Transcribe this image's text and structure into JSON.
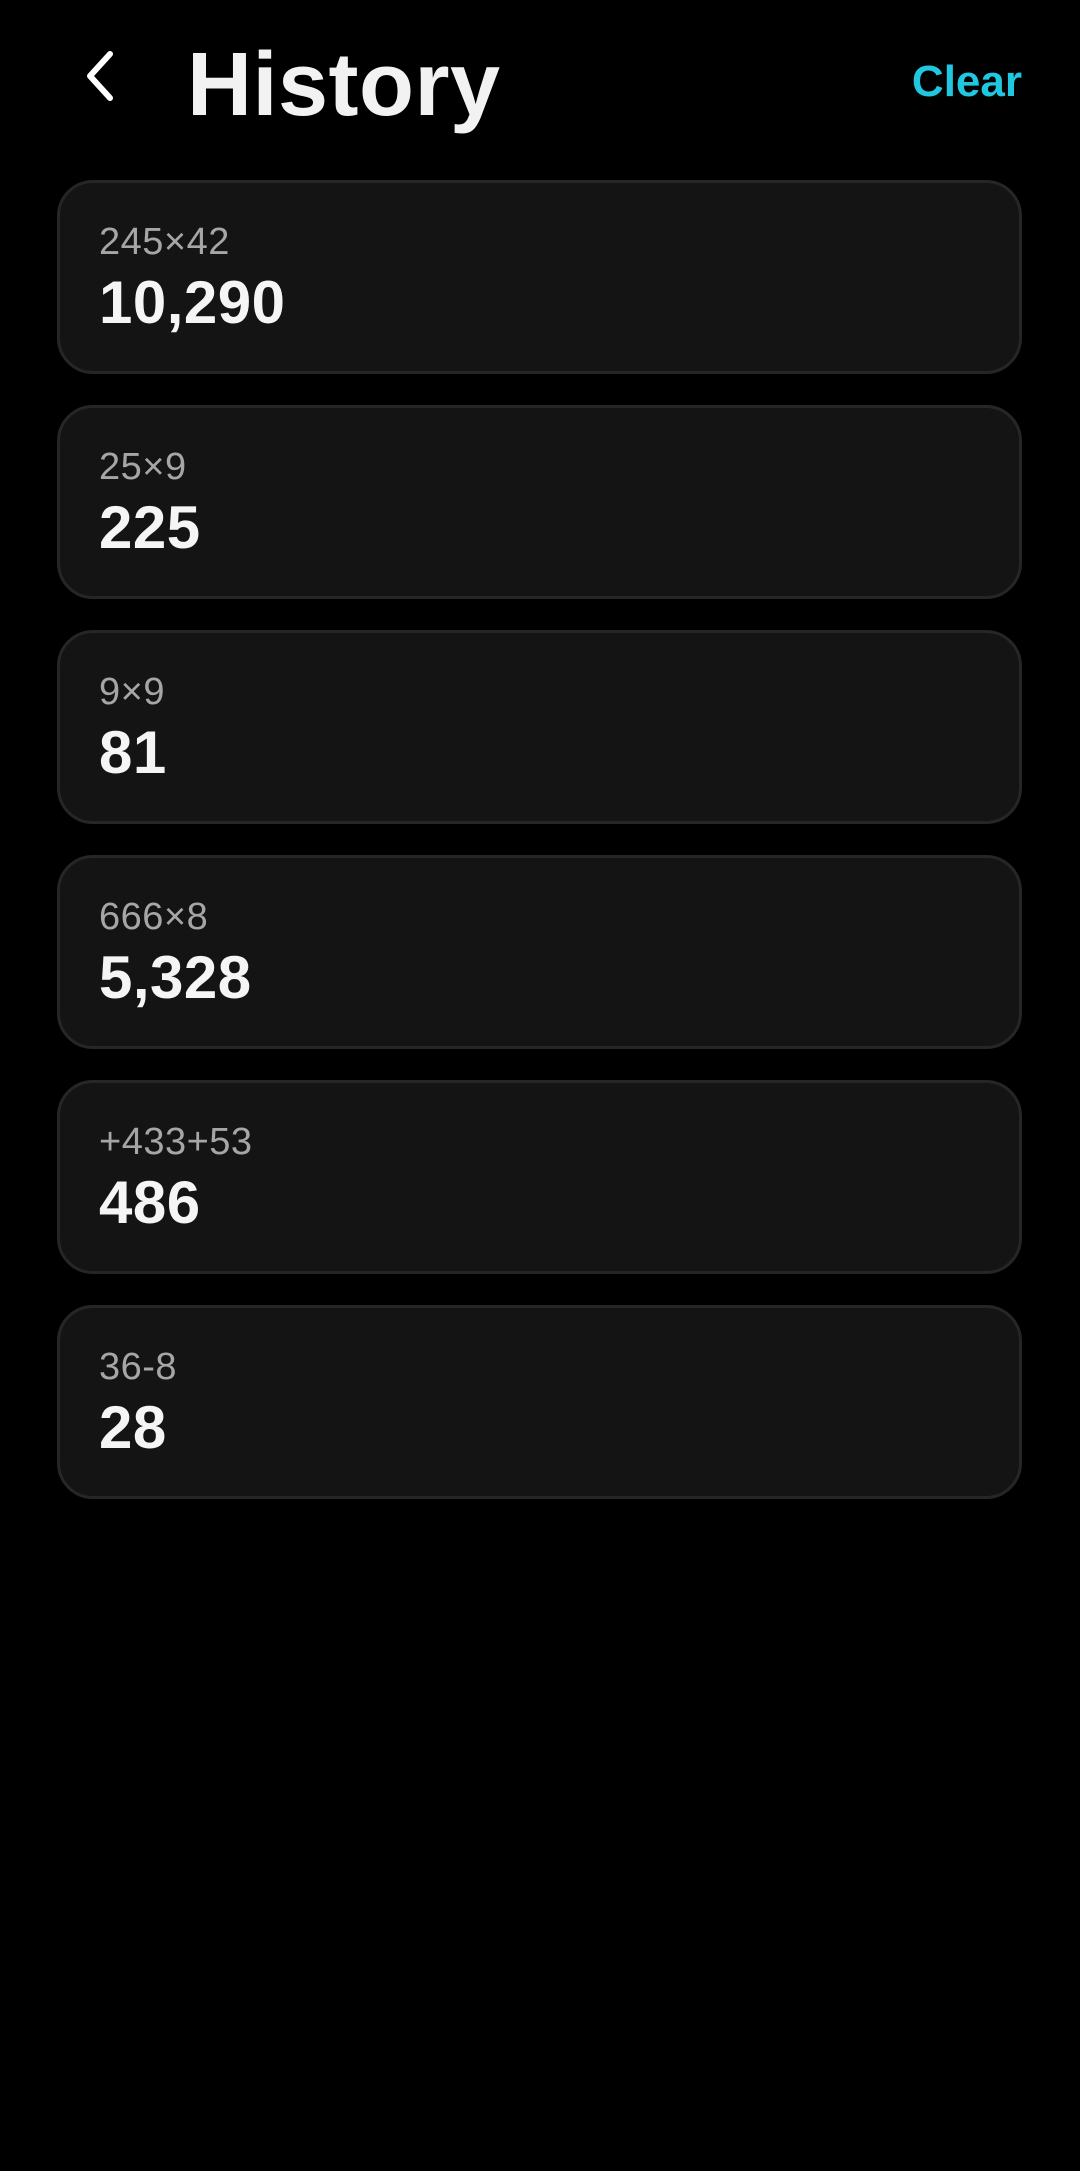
{
  "header": {
    "title": "History",
    "clear_label": "Clear",
    "back_icon": "chevron-left-icon"
  },
  "colors": {
    "background": "#000000",
    "card": "#141414",
    "accent": "#1fc8e0",
    "expression_text": "#a6a6a6",
    "result_text": "#f5f5f5"
  },
  "history": [
    {
      "expression": "245×42",
      "result": "10,290"
    },
    {
      "expression": "25×9",
      "result": "225"
    },
    {
      "expression": "9×9",
      "result": "81"
    },
    {
      "expression": "666×8",
      "result": "5,328"
    },
    {
      "expression": "+433+53",
      "result": "486"
    },
    {
      "expression": "36-8",
      "result": "28"
    }
  ]
}
